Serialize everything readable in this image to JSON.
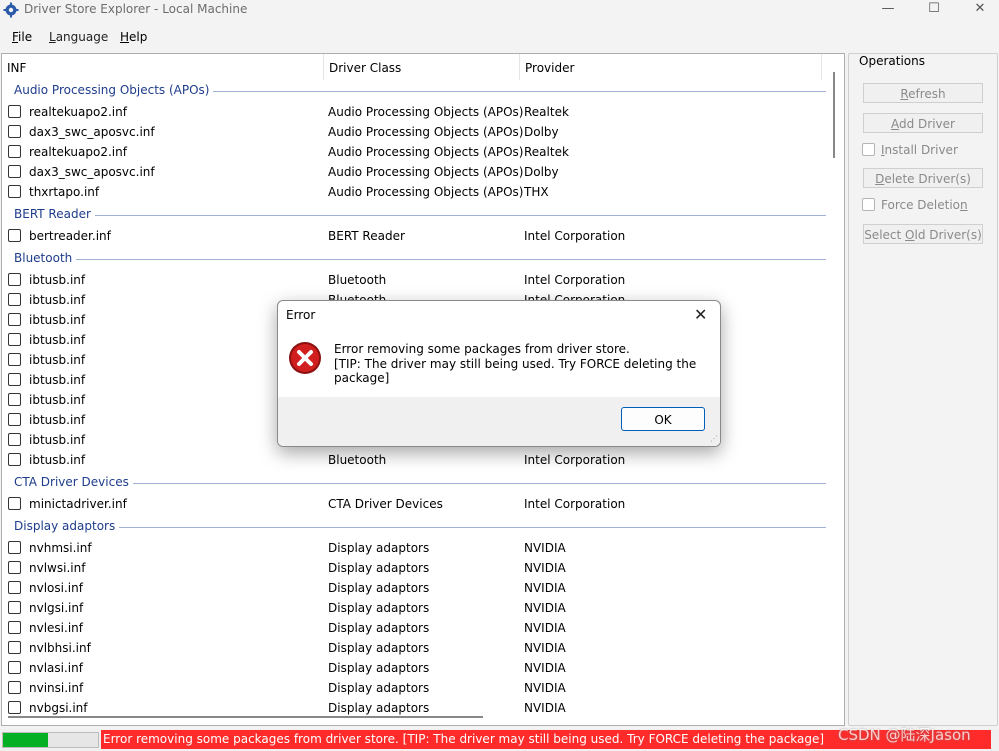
{
  "window": {
    "title": "Driver Store Explorer - Local Machine",
    "minimize": "—",
    "maximize": "☐",
    "close": "✕"
  },
  "menu": {
    "file_u": "F",
    "file_rest": "ile",
    "language_u": "L",
    "language_rest": "anguage",
    "help_u": "H",
    "help_rest": "elp"
  },
  "columns": {
    "inf": "INF",
    "driver_class": "Driver Class",
    "provider": "Provider",
    "sort_indicator": "^"
  },
  "groups": [
    {
      "label": "Audio Processing Objects (APOs)",
      "rows": [
        {
          "inf": "realtekuapo2.inf",
          "cls": "Audio Processing Objects (APOs)",
          "prov": "Realtek"
        },
        {
          "inf": "dax3_swc_aposvc.inf",
          "cls": "Audio Processing Objects (APOs)",
          "prov": "Dolby"
        },
        {
          "inf": "realtekuapo2.inf",
          "cls": "Audio Processing Objects (APOs)",
          "prov": "Realtek"
        },
        {
          "inf": "dax3_swc_aposvc.inf",
          "cls": "Audio Processing Objects (APOs)",
          "prov": "Dolby"
        },
        {
          "inf": "thxrtapo.inf",
          "cls": "Audio Processing Objects (APOs)",
          "prov": "THX"
        }
      ]
    },
    {
      "label": "BERT Reader",
      "rows": [
        {
          "inf": "bertreader.inf",
          "cls": "BERT Reader",
          "prov": "Intel Corporation"
        }
      ]
    },
    {
      "label": "Bluetooth",
      "rows": [
        {
          "inf": "ibtusb.inf",
          "cls": "Bluetooth",
          "prov": "Intel Corporation"
        },
        {
          "inf": "ibtusb.inf",
          "cls": "Bluetooth",
          "prov": "Intel Corporation"
        },
        {
          "inf": "ibtusb.inf",
          "cls": "",
          "prov": ""
        },
        {
          "inf": "ibtusb.inf",
          "cls": "",
          "prov": ""
        },
        {
          "inf": "ibtusb.inf",
          "cls": "",
          "prov": ""
        },
        {
          "inf": "ibtusb.inf",
          "cls": "",
          "prov": ""
        },
        {
          "inf": "ibtusb.inf",
          "cls": "",
          "prov": ""
        },
        {
          "inf": "ibtusb.inf",
          "cls": "",
          "prov": ""
        },
        {
          "inf": "ibtusb.inf",
          "cls": "",
          "prov": ""
        },
        {
          "inf": "ibtusb.inf",
          "cls": "Bluetooth",
          "prov": "Intel Corporation"
        }
      ]
    },
    {
      "label": "CTA Driver Devices",
      "rows": [
        {
          "inf": "minictadriver.inf",
          "cls": "CTA Driver Devices",
          "prov": "Intel Corporation"
        }
      ]
    },
    {
      "label": "Display adaptors",
      "rows": [
        {
          "inf": "nvhmsi.inf",
          "cls": "Display adaptors",
          "prov": "NVIDIA"
        },
        {
          "inf": "nvlwsi.inf",
          "cls": "Display adaptors",
          "prov": "NVIDIA"
        },
        {
          "inf": "nvlosi.inf",
          "cls": "Display adaptors",
          "prov": "NVIDIA"
        },
        {
          "inf": "nvlgsi.inf",
          "cls": "Display adaptors",
          "prov": "NVIDIA"
        },
        {
          "inf": "nvlesi.inf",
          "cls": "Display adaptors",
          "prov": "NVIDIA"
        },
        {
          "inf": "nvlbhsi.inf",
          "cls": "Display adaptors",
          "prov": "NVIDIA"
        },
        {
          "inf": "nvlasi.inf",
          "cls": "Display adaptors",
          "prov": "NVIDIA"
        },
        {
          "inf": "nvinsi.inf",
          "cls": "Display adaptors",
          "prov": "NVIDIA"
        },
        {
          "inf": "nvbgsi.inf",
          "cls": "Display adaptors",
          "prov": "NVIDIA"
        }
      ]
    }
  ],
  "operations": {
    "title": "Operations",
    "refresh_u": "R",
    "refresh_rest": "efresh",
    "add_u": "A",
    "add_rest": "dd Driver",
    "install_u": "I",
    "install_rest": "nstall Driver",
    "delete_pre": "D",
    "delete_rest": "elete Driver(s)",
    "force_pre": "Force Deletio",
    "force_u": "n",
    "select_pre": "Select ",
    "select_u": "O",
    "select_rest": "ld Driver(s)"
  },
  "status": {
    "progress": 0.47,
    "message": "Error removing some packages from driver store. [TIP: The driver may still being used. Try FORCE deleting the package]"
  },
  "dialog": {
    "title": "Error",
    "close": "✕",
    "line1": "Error removing some packages from driver store.",
    "line2": "[TIP: The driver may still being used. Try FORCE deleting the package]",
    "ok": "OK",
    "grip": "⋰"
  },
  "watermark": "CSDN @陆深Jason"
}
